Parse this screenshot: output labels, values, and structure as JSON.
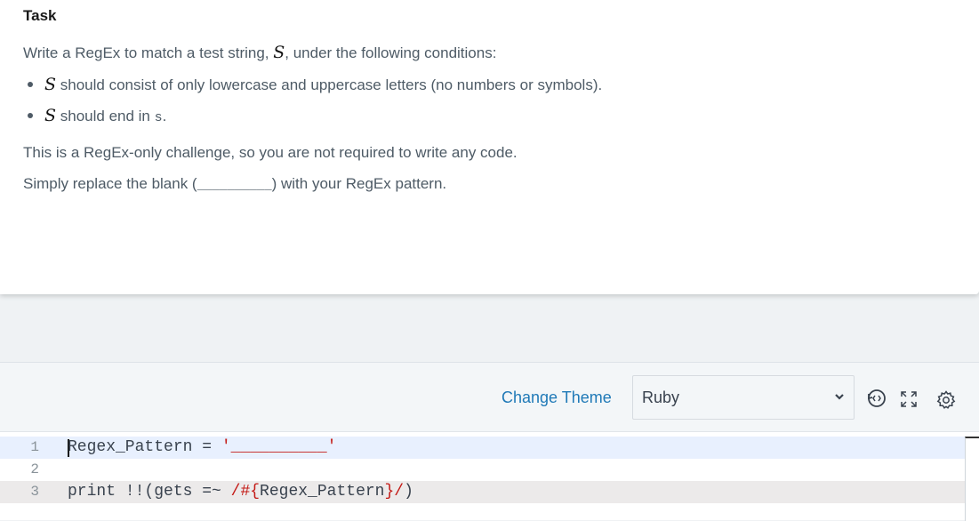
{
  "task": {
    "heading": "Task",
    "intro_pre": "Write a RegEx to match a test string, ",
    "var": "S",
    "intro_post": ", under the following conditions:",
    "bullets": [
      {
        "var": "S",
        "text": " should consist of only lowercase and uppercase letters (no numbers or symbols)."
      },
      {
        "var": "S",
        "text_pre": " should end in ",
        "code": "s",
        "text_post": "."
      }
    ],
    "para1": "This is a RegEx-only challenge, so you are not required to write any code.",
    "para2_pre": "Simply replace the blank (",
    "para2_blank": "__________",
    "para2_post": ") with your RegEx pattern."
  },
  "toolbar": {
    "change_theme": "Change Theme",
    "language": "Ruby",
    "icons": [
      "restore-icon",
      "fullscreen-icon",
      "settings-icon"
    ]
  },
  "editor": {
    "lines": [
      {
        "num": "1",
        "text_var": "Regex_Pattern",
        "text_op": " = ",
        "text_str": "'__________'"
      },
      {
        "num": "2"
      },
      {
        "num": "3",
        "text_a": "print !!(gets =~ ",
        "text_str": "/#{",
        "text_b": "Regex_Pattern",
        "text_str2": "}/",
        "text_c": ")"
      }
    ]
  },
  "colors": {
    "link": "#1f79b7",
    "text": "#4e5b66",
    "string": "#c41a16",
    "active_line": "#e8f0fe",
    "selected_line": "#eceaea"
  }
}
